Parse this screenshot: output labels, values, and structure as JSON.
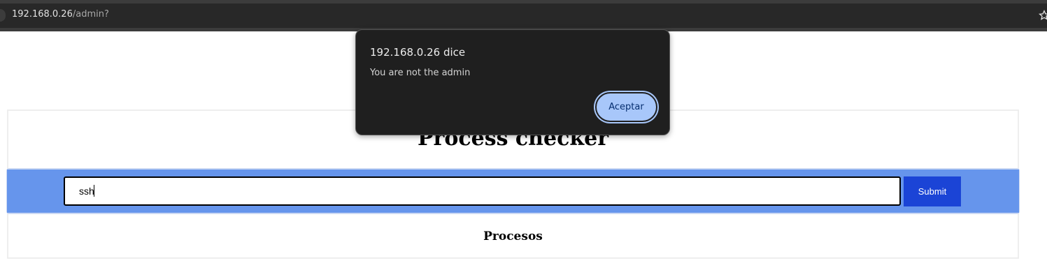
{
  "browser": {
    "url_host": "192.168.0.26",
    "url_path": "/admin?",
    "bookmark_icon": "star-icon"
  },
  "page": {
    "title": "Process checker",
    "search": {
      "value": "ssh",
      "submit_label": "Submit"
    },
    "processes_heading": "Procesos"
  },
  "dialog": {
    "title": "192.168.0.26 dice",
    "message": "You are not the admin",
    "accept_label": "Aceptar"
  },
  "colors": {
    "band": "#6695ec",
    "submit": "#1b44d6",
    "dialog_bg": "#1f1f1f",
    "dialog_button": "#a8c7fa"
  }
}
